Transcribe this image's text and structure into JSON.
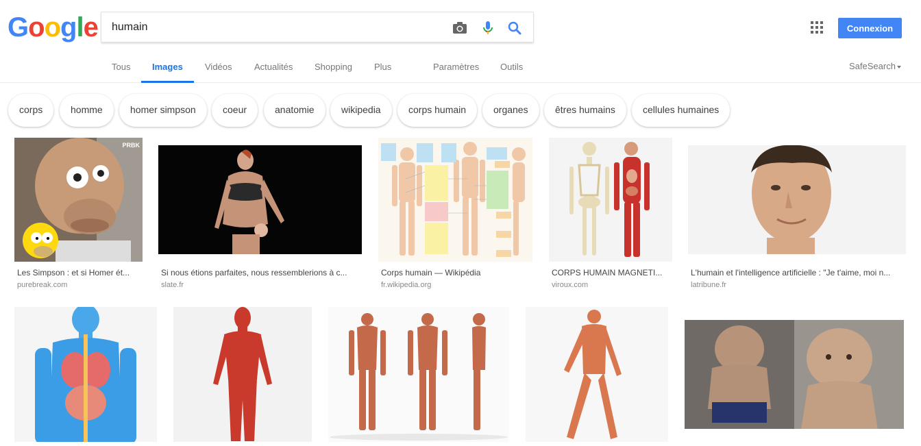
{
  "logo": {
    "letters": [
      "G",
      "o",
      "o",
      "g",
      "l",
      "e"
    ],
    "colors": [
      "#4285f4",
      "#ea4335",
      "#fbbc05",
      "#4285f4",
      "#34a853",
      "#ea4335"
    ]
  },
  "search": {
    "query": "humain",
    "icons": [
      "camera-icon",
      "microphone-icon",
      "search-icon"
    ]
  },
  "header": {
    "apps_icon": "apps-grid-icon",
    "signin_label": "Connexion",
    "accent": "#4285f4"
  },
  "tabs": [
    {
      "label": "Tous"
    },
    {
      "label": "Images",
      "active": true
    },
    {
      "label": "Vidéos"
    },
    {
      "label": "Actualités"
    },
    {
      "label": "Shopping"
    },
    {
      "label": "Plus"
    },
    {
      "label": "Paramètres"
    },
    {
      "label": "Outils"
    }
  ],
  "safesearch": "SafeSearch",
  "chips": [
    "corps",
    "homme",
    "homer simpson",
    "coeur",
    "anatomie",
    "wikipedia",
    "corps humain",
    "organes",
    "êtres humains",
    "cellules humaines"
  ],
  "results": [
    {
      "title": "Les Simpson : et si Homer ét...",
      "source": "purebreak.com",
      "badge": "PRBK"
    },
    {
      "title": "Si nous étions parfaites, nous ressemblerions à c...",
      "source": "slate.fr"
    },
    {
      "title": "Corps humain — Wikipédia",
      "source": "fr.wikipedia.org"
    },
    {
      "title": "CORPS HUMAIN MAGNETI...",
      "source": "viroux.com"
    },
    {
      "title": "L'humain et l'intelligence artificielle : \"Je t'aime, moi n...",
      "source": "latribune.fr"
    },
    {
      "title": "",
      "source": ""
    },
    {
      "title": "",
      "source": ""
    },
    {
      "title": "",
      "source": ""
    },
    {
      "title": "",
      "source": ""
    },
    {
      "title": "",
      "source": ""
    }
  ]
}
